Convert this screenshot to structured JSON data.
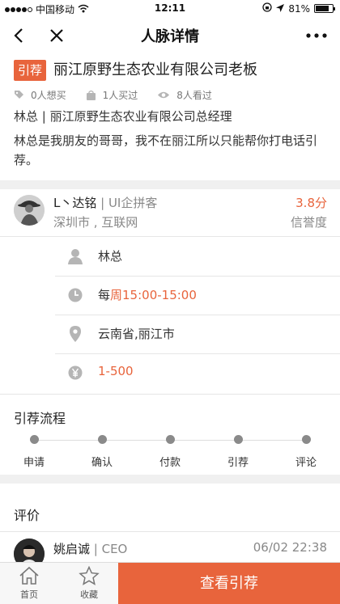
{
  "status_bar": {
    "carrier": "中国移动",
    "time": "12:11",
    "battery": "81%",
    "battery_level": 0.81
  },
  "nav": {
    "title": "人脉详情"
  },
  "header": {
    "tag": "引荐",
    "title": "丽江原野生态农业有限公司老板",
    "stats": {
      "want": "0人想买",
      "bought": "1人买过",
      "viewed": "8人看过"
    },
    "subtitle": "林总 | 丽江原野生态农业有限公司总经理",
    "description": "林总是我朋友的哥哥，我不在丽江所以只能帮你打电话引荐。"
  },
  "provider": {
    "name": "L丶达铭",
    "role": "UI企拼客",
    "location": "深圳市 , 互联网",
    "score": "3.8分",
    "score_label": "信誉度"
  },
  "details": {
    "contact": "林总",
    "time_prefix": "每",
    "time_value": "周15:00-15:00",
    "location": "云南省,丽江市",
    "price": "1-500"
  },
  "flow": {
    "title": "引荐流程",
    "steps": [
      "申请",
      "确认",
      "付款",
      "引荐",
      "评论"
    ]
  },
  "reviews": {
    "title": "评价",
    "items": [
      {
        "name": "姚启诚",
        "role": "CEO",
        "time": "06/02 22:38"
      }
    ]
  },
  "bottom_bar": {
    "home": "首页",
    "favorite": "收藏",
    "cta": "查看引荐"
  },
  "colors": {
    "accent": "#e8643c",
    "icon_gray": "#b5b5b5"
  }
}
